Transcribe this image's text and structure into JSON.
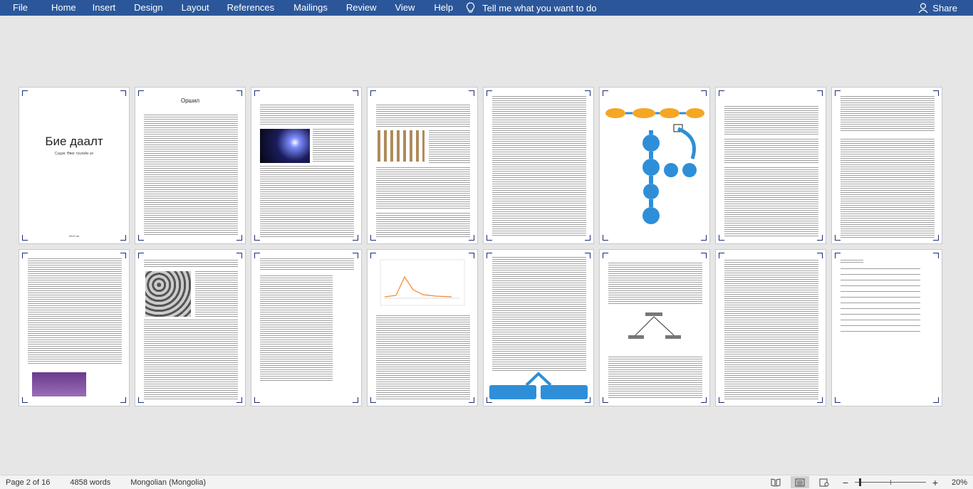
{
  "ribbon": {
    "tabs": [
      "File",
      "Home",
      "Insert",
      "Design",
      "Layout",
      "References",
      "Mailings",
      "Review",
      "View",
      "Help"
    ],
    "tell_me": "Tell me what you want to do",
    "share": "Share"
  },
  "cover": {
    "title": "Бие даалт",
    "subtitle": "Сэдэв: Өвөг түүхийн үе",
    "year": "2019 он"
  },
  "pages": {
    "p2_heading": "Оршил"
  },
  "status": {
    "page": "Page 2 of 16",
    "words": "4858 words",
    "language": "Mongolian (Mongolia)",
    "zoom": "20%",
    "zoom_fraction": 0.2
  },
  "colors": {
    "ribbon": "#2b579a",
    "canvas": "#e6e6e6",
    "statusbar": "#f3f3f3",
    "accent_shapes": "#f5a623",
    "diagram_blue": "#2e8fd8"
  },
  "icons": [
    "lightbulb-icon",
    "person-icon",
    "read-mode-icon",
    "print-layout-icon",
    "web-layout-icon"
  ]
}
